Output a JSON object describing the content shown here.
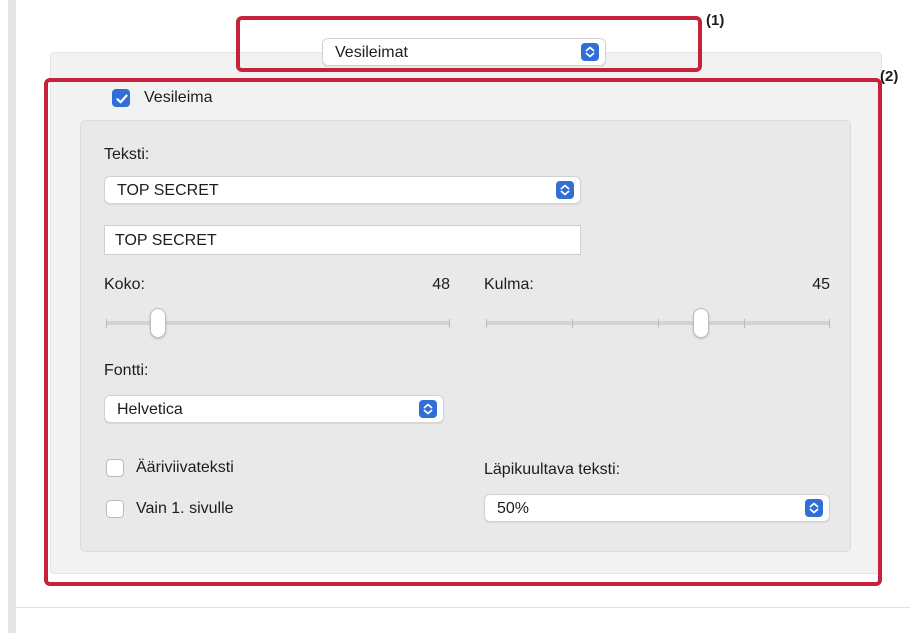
{
  "header": {
    "panel_select": {
      "value": "Vesileimat"
    },
    "callout_1": "(1)",
    "callout_2": "(2)"
  },
  "watermark": {
    "enable_checkbox": {
      "label": "Vesileima",
      "checked": true
    },
    "text_section": {
      "label": "Teksti:",
      "preset_select": "TOP SECRET",
      "custom_text_value": "TOP SECRET"
    },
    "size": {
      "label": "Koko:",
      "value": "48",
      "slider_fraction": 0.15
    },
    "angle": {
      "label": "Kulma:",
      "value": "45",
      "slider_fraction": 0.625
    },
    "font": {
      "label": "Fontti:",
      "value": "Helvetica"
    },
    "outline_checkbox": {
      "label": "Ääriviivateksti",
      "checked": false
    },
    "first_page_checkbox": {
      "label": "Vain 1. sivulle",
      "checked": false
    },
    "transparency": {
      "label": "Läpikuultava teksti:",
      "value": "50%"
    }
  },
  "colors": {
    "accent": "#2f6fd6",
    "highlight": "#c8223a"
  }
}
